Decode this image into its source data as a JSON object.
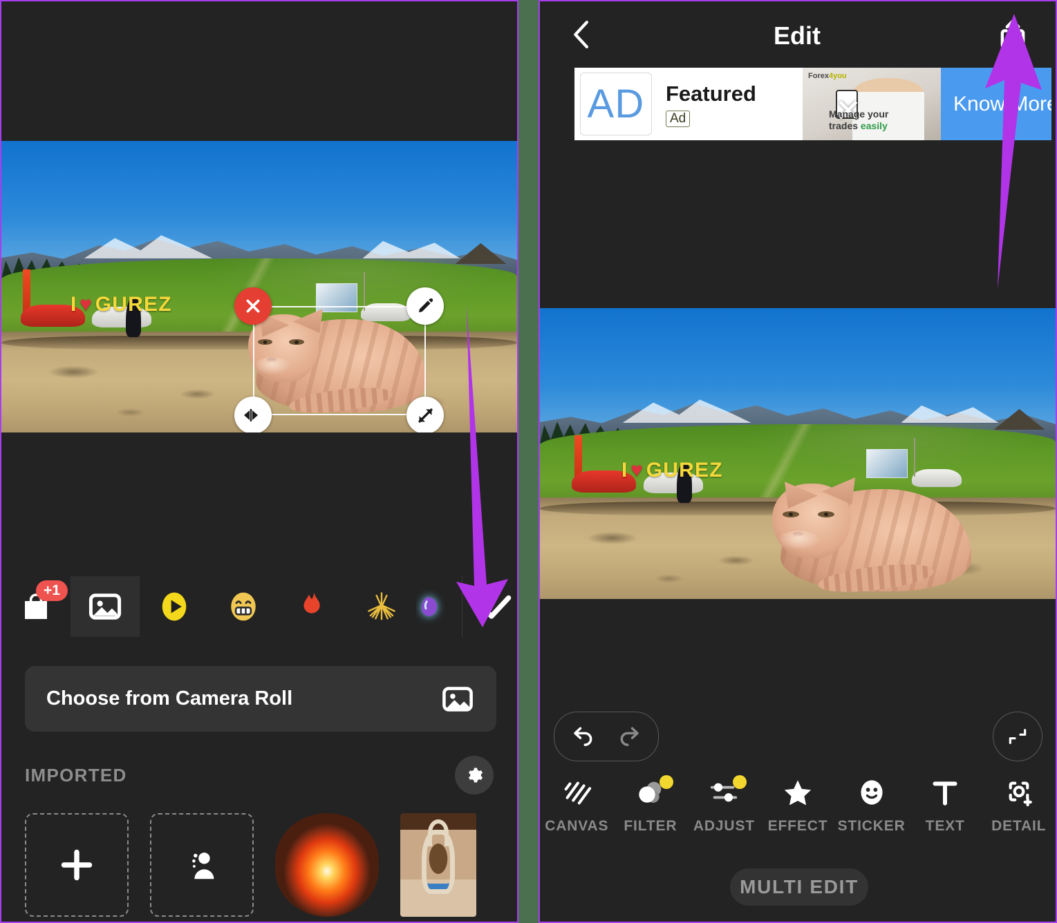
{
  "left_panel": {
    "canvas": {
      "photo_alt": "Mountain meadow landscape with I love Gurez sign, cars and people",
      "sign_text": "I",
      "sign_heart": "♥",
      "sign_text2": "GUREZ",
      "sticker_alt": "Ginger cat cutout sticker placed on the photo"
    },
    "selection_handles": [
      {
        "name": "delete-handle",
        "icon": "close-icon"
      },
      {
        "name": "edit-handle",
        "icon": "pencil-icon"
      },
      {
        "name": "flip-handle",
        "icon": "flip-horizontal-icon"
      },
      {
        "name": "resize-handle",
        "icon": "resize-diagonal-icon"
      }
    ],
    "tabs": [
      {
        "id": "store",
        "icon": "shopping-bag-icon",
        "badge": "+1",
        "active": false
      },
      {
        "id": "photo",
        "icon": "photo-image-icon",
        "badge": "",
        "active": true
      },
      {
        "id": "gif",
        "icon": "play-gif-icon",
        "badge": "",
        "active": false
      },
      {
        "id": "emoji",
        "icon": "grin-emoji-icon",
        "badge": "",
        "active": false
      },
      {
        "id": "flame",
        "icon": "flame-icon",
        "badge": "",
        "active": false
      },
      {
        "id": "sparkle",
        "icon": "firework-icon",
        "badge": "",
        "active": false
      },
      {
        "id": "neon",
        "icon": "neon-sticker-icon",
        "badge": "",
        "active": false
      }
    ],
    "confirm": {
      "label": "",
      "icon": "checkmark-icon"
    },
    "camera_roll": {
      "label": "Choose from Camera Roll",
      "icon": "photo-image-icon"
    },
    "imported": {
      "title": "IMPORTED",
      "settings_icon": "gear-icon",
      "items": [
        {
          "id": "add",
          "icon": "plus-icon",
          "type": "placeholder"
        },
        {
          "id": "cutout",
          "icon": "person-cutout-icon",
          "type": "placeholder"
        },
        {
          "id": "glow-ball",
          "icon": "",
          "type": "sticker"
        },
        {
          "id": "basket-photo",
          "icon": "",
          "type": "photo"
        }
      ]
    }
  },
  "right_panel": {
    "topbar": {
      "back_icon": "chevron-left-icon",
      "title": "Edit",
      "share_icon": "share-upload-icon"
    },
    "ad": {
      "logo_text": "AD",
      "title": "Featured",
      "tag": "Ad",
      "brand": "Forex",
      "brand_accent": "4you",
      "caption_line1": "Manage your",
      "caption_line2": "trades ",
      "caption_accent": "easily",
      "cta_label": "Know More",
      "close_icon": "close-icon"
    },
    "canvas": {
      "photo_alt": "Edited photo with ginger cat sticker composited onto the meadow scene"
    },
    "history": {
      "undo_icon": "undo-arrow-icon",
      "redo_icon": "redo-arrow-icon",
      "fit_icon": "collapse-fit-icon"
    },
    "tools": [
      {
        "id": "canvas",
        "label": "CANVAS",
        "icon": "canvas-stripes-icon",
        "dot": false
      },
      {
        "id": "filter",
        "label": "FILTER",
        "icon": "filter-circles-icon",
        "dot": true
      },
      {
        "id": "adjust",
        "label": "ADJUST",
        "icon": "sliders-icon",
        "dot": true
      },
      {
        "id": "effect",
        "label": "EFFECT",
        "icon": "star-icon",
        "dot": false
      },
      {
        "id": "sticker",
        "label": "STICKER",
        "icon": "smiley-icon",
        "dot": false
      },
      {
        "id": "text",
        "label": "TEXT",
        "icon": "text-t-icon",
        "dot": false
      },
      {
        "id": "detail",
        "label": "DETAIL",
        "icon": "detail-focus-icon",
        "dot": false
      }
    ],
    "multi_edit": {
      "label": "MULTI EDIT"
    }
  },
  "annotations": {
    "arrow_color": "#b234e8",
    "left_arrow_points_to": "confirm-checkmark-button",
    "right_arrow_points_to": "share-button"
  },
  "colors": {
    "panel_border": "#a83df0",
    "divider": "#4a7050",
    "background": "#232323",
    "badge_red": "#ef5350",
    "accent_yellow": "#f2d72e",
    "ad_blue": "#4a9af0",
    "delete_red": "#e53e32"
  }
}
